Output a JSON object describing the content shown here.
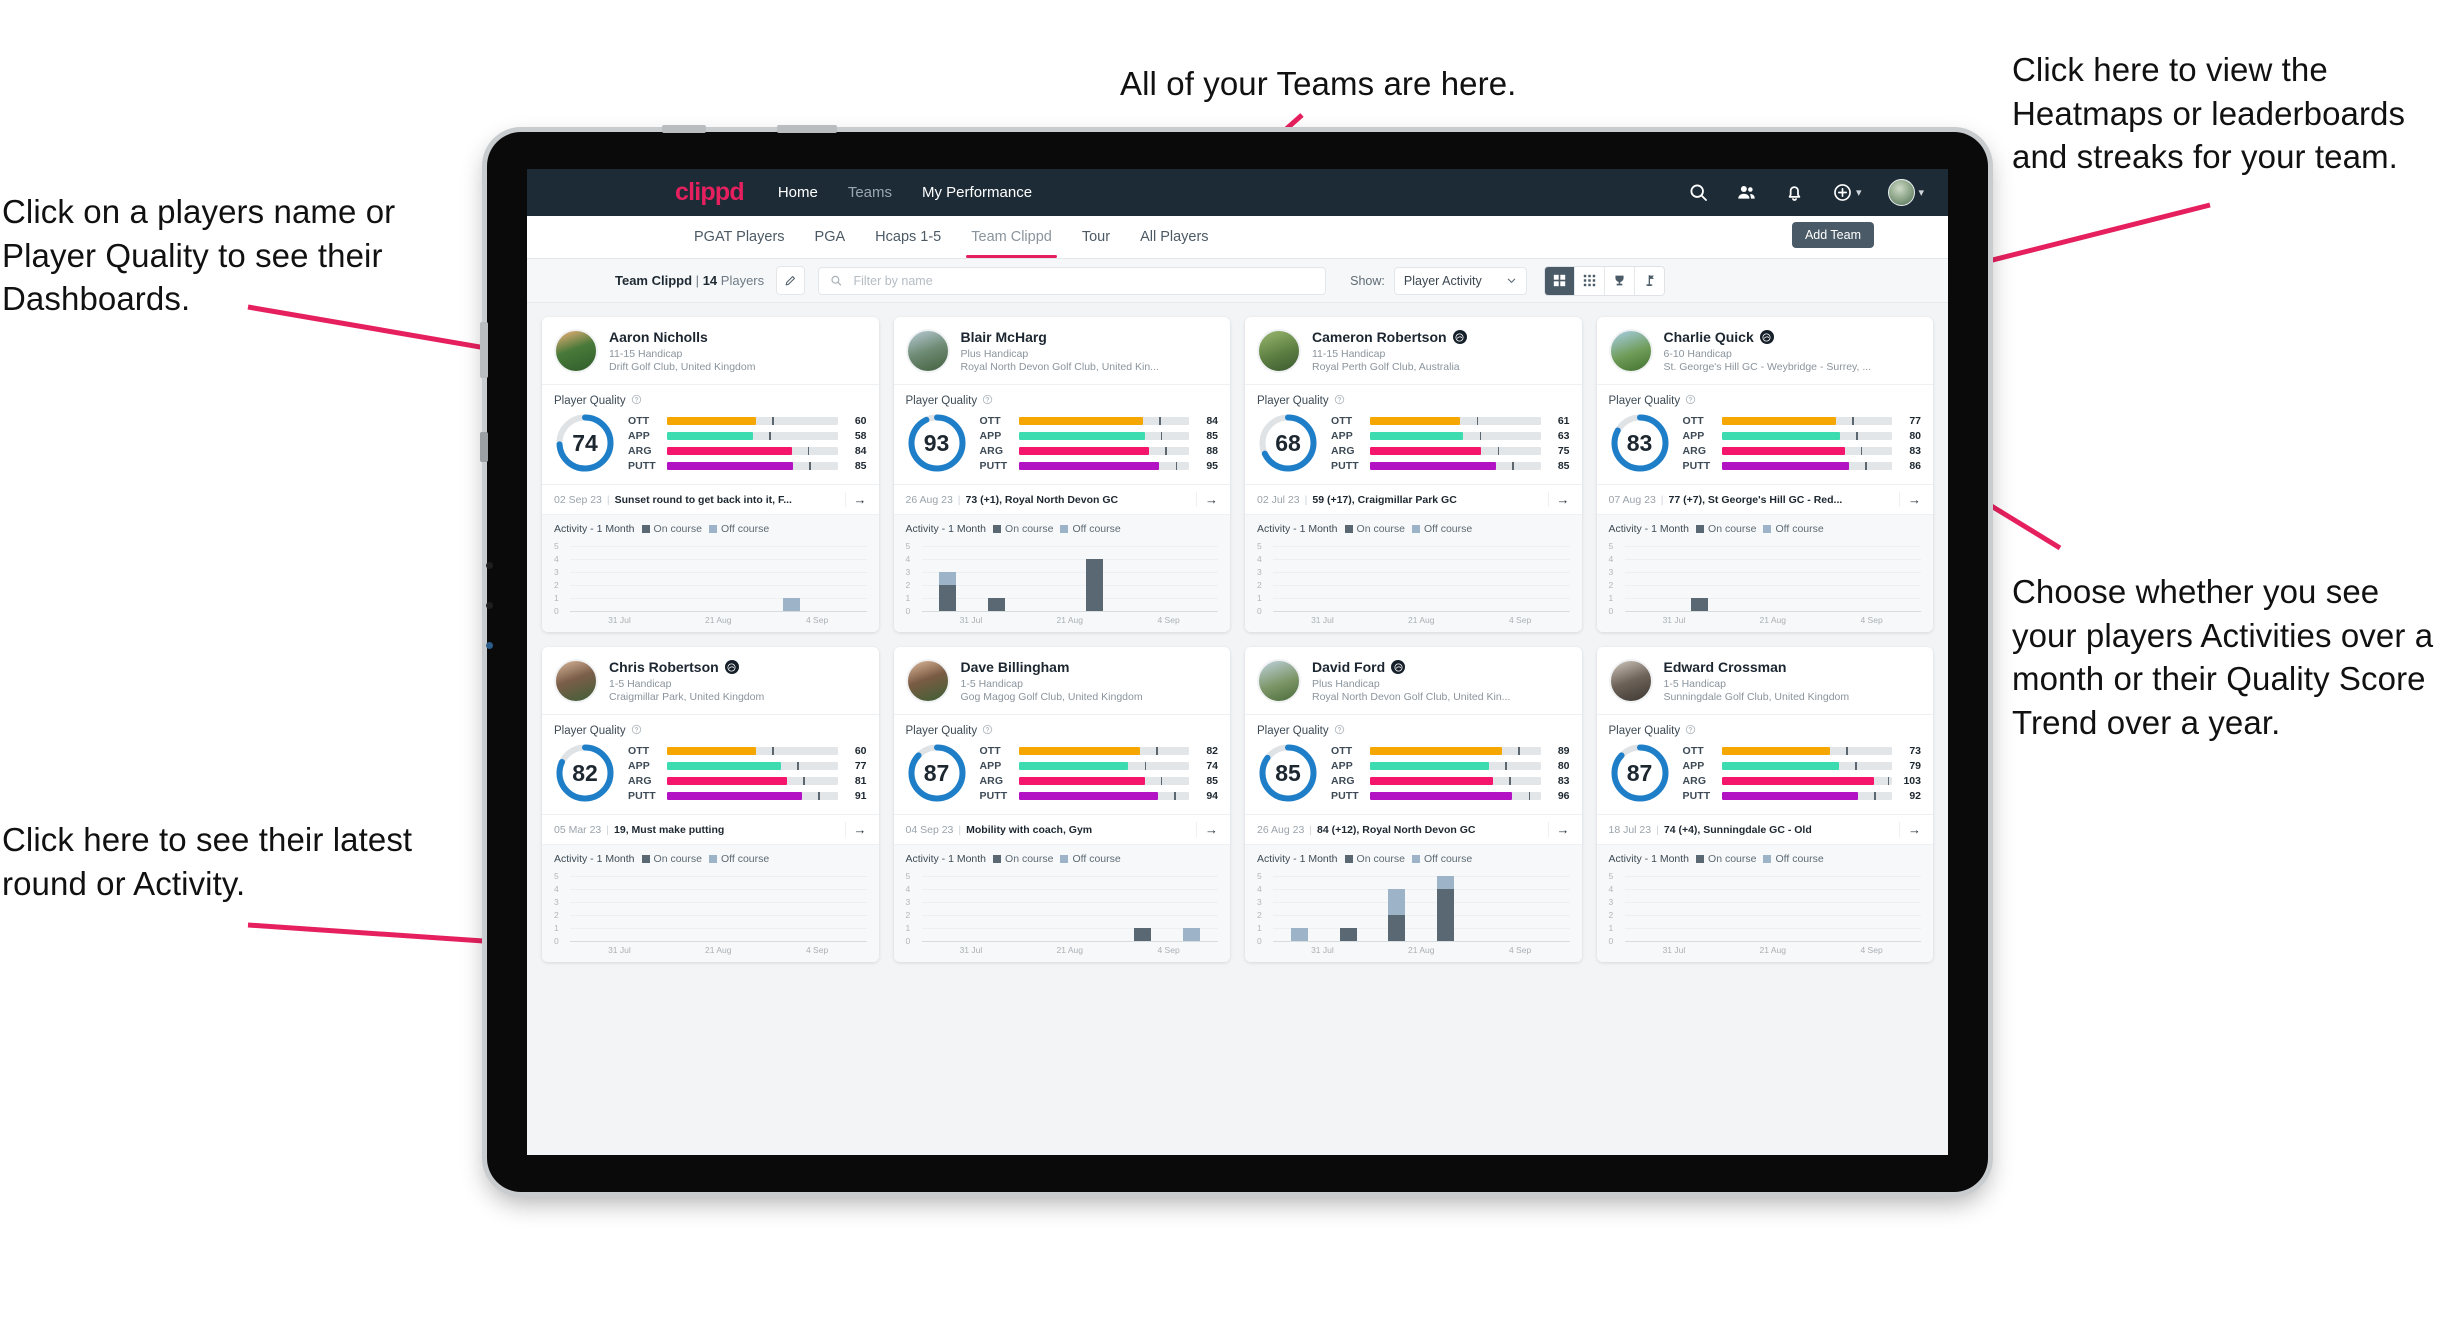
{
  "annotations": {
    "left_top": "Click on a players name or Player Quality to see their Dashboards.",
    "left_bottom": "Click here to see their latest round or Activity.",
    "top": "All of your Teams are here.",
    "right_top": "Click here to view the Heatmaps or leaderboards and streaks for your team.",
    "right_bottom": "Choose whether you see your players Activities over a month or their Quality Score Trend over a year."
  },
  "colors": {
    "accent": "#e6205e",
    "topnav_bg": "#1c2b36",
    "ott": "#f5a700",
    "app": "#3ddcb0",
    "arg": "#f5156c",
    "putt": "#b312c4",
    "donut": "#1e7ec8",
    "on_course": "#5a6873",
    "off_course": "#9db4c8"
  },
  "topnav": {
    "logo": "clippd",
    "links": [
      {
        "label": "Home",
        "active": true
      },
      {
        "label": "Teams",
        "active": false
      },
      {
        "label": "My Performance",
        "active": true
      }
    ],
    "icons": [
      "search-icon",
      "people-icon",
      "bell-icon",
      "add-circle-icon",
      "avatar"
    ]
  },
  "tabs": [
    {
      "label": "PGAT Players",
      "active": false
    },
    {
      "label": "PGA",
      "active": false
    },
    {
      "label": "Hcaps 1-5",
      "active": false
    },
    {
      "label": "Team Clippd",
      "active": true
    },
    {
      "label": "Tour",
      "active": false
    },
    {
      "label": "All Players",
      "active": false
    }
  ],
  "add_team_label": "Add Team",
  "filterbar": {
    "team_name": "Team Clippd",
    "separator": "|",
    "player_count": "14",
    "players_word": "Players",
    "edit_icon": "pencil-icon",
    "search_placeholder": "Filter by name",
    "search_value": "",
    "show_label": "Show:",
    "show_value": "Player Activity",
    "show_options": [
      "Player Activity",
      "Quality Score Trend"
    ],
    "view_buttons": [
      {
        "icon": "grid-view-icon",
        "active": true
      },
      {
        "icon": "dense-grid-icon",
        "active": false
      },
      {
        "icon": "trophy-icon",
        "active": false
      },
      {
        "icon": "flag-icon",
        "active": false
      }
    ]
  },
  "card_labels": {
    "player_quality": "Player Quality",
    "help_icon": "help-circle-icon",
    "activity": "Activity - 1 Month",
    "on_course": "On course",
    "off_course": "Off course",
    "arrow_icon": "arrow-right-icon"
  },
  "skill_keys": [
    "OTT",
    "APP",
    "ARG",
    "PUTT"
  ],
  "chart_axis": {
    "y_ticks": [
      "5",
      "4",
      "3",
      "2",
      "1",
      "0"
    ],
    "x_ticks": [
      "31 Jul",
      "21 Aug",
      "4 Sep"
    ],
    "ylim": [
      0,
      5
    ]
  },
  "players": [
    {
      "name": "Aaron Nicholls",
      "verified": false,
      "handicap": "11-15 Handicap",
      "club": "Drift Golf Club, United Kingdom",
      "quality": 74,
      "skills": {
        "OTT": 60,
        "APP": 58,
        "ARG": 84,
        "PUTT": 85
      },
      "last_date": "02 Sep 23",
      "last_text": "Sunset round to get back into it, F...",
      "chart_data": {
        "type": "bar",
        "title": "Activity - 1 Month",
        "categories": [
          "b1",
          "b2",
          "b3",
          "b4",
          "b5",
          "b6"
        ],
        "series": [
          {
            "name": "On course",
            "values": [
              0,
              0,
              0,
              0,
              0,
              0
            ]
          },
          {
            "name": "Off course",
            "values": [
              0,
              0,
              0,
              0,
              1,
              0
            ]
          }
        ],
        "ylim": [
          0,
          5
        ]
      }
    },
    {
      "name": "Blair McHarg",
      "verified": false,
      "handicap": "Plus Handicap",
      "club": "Royal North Devon Golf Club, United Kin...",
      "quality": 93,
      "skills": {
        "OTT": 84,
        "APP": 85,
        "ARG": 88,
        "PUTT": 95
      },
      "last_date": "26 Aug 23",
      "last_text": "73 (+1), Royal North Devon GC",
      "chart_data": {
        "type": "bar",
        "title": "Activity - 1 Month",
        "categories": [
          "b1",
          "b2",
          "b3",
          "b4",
          "b5",
          "b6"
        ],
        "series": [
          {
            "name": "On course",
            "values": [
              2,
              1,
              0,
              4,
              0,
              0
            ]
          },
          {
            "name": "Off course",
            "values": [
              1,
              0,
              0,
              0,
              0,
              0
            ]
          }
        ],
        "ylim": [
          0,
          5
        ]
      }
    },
    {
      "name": "Cameron Robertson",
      "verified": true,
      "handicap": "11-15 Handicap",
      "club": "Royal Perth Golf Club, Australia",
      "quality": 68,
      "skills": {
        "OTT": 61,
        "APP": 63,
        "ARG": 75,
        "PUTT": 85
      },
      "last_date": "02 Jul 23",
      "last_text": "59 (+17), Craigmillar Park GC",
      "chart_data": {
        "type": "bar",
        "title": "Activity - 1 Month",
        "categories": [
          "b1",
          "b2",
          "b3",
          "b4",
          "b5",
          "b6"
        ],
        "series": [
          {
            "name": "On course",
            "values": [
              0,
              0,
              0,
              0,
              0,
              0
            ]
          },
          {
            "name": "Off course",
            "values": [
              0,
              0,
              0,
              0,
              0,
              0
            ]
          }
        ],
        "ylim": [
          0,
          5
        ]
      }
    },
    {
      "name": "Charlie Quick",
      "verified": true,
      "handicap": "6-10 Handicap",
      "club": "St. George's Hill GC - Weybridge - Surrey, ...",
      "quality": 83,
      "skills": {
        "OTT": 77,
        "APP": 80,
        "ARG": 83,
        "PUTT": 86
      },
      "last_date": "07 Aug 23",
      "last_text": "77 (+7), St George's Hill GC - Red...",
      "chart_data": {
        "type": "bar",
        "title": "Activity - 1 Month",
        "categories": [
          "b1",
          "b2",
          "b3",
          "b4",
          "b5",
          "b6"
        ],
        "series": [
          {
            "name": "On course",
            "values": [
              0,
              1,
              0,
              0,
              0,
              0
            ]
          },
          {
            "name": "Off course",
            "values": [
              0,
              0,
              0,
              0,
              0,
              0
            ]
          }
        ],
        "ylim": [
          0,
          5
        ]
      }
    },
    {
      "name": "Chris Robertson",
      "verified": true,
      "handicap": "1-5 Handicap",
      "club": "Craigmillar Park, United Kingdom",
      "quality": 82,
      "skills": {
        "OTT": 60,
        "APP": 77,
        "ARG": 81,
        "PUTT": 91
      },
      "last_date": "05 Mar 23",
      "last_text": "19, Must make putting",
      "chart_data": {
        "type": "bar",
        "title": "Activity - 1 Month",
        "categories": [
          "b1",
          "b2",
          "b3",
          "b4",
          "b5",
          "b6"
        ],
        "series": [
          {
            "name": "On course",
            "values": [
              0,
              0,
              0,
              0,
              0,
              0
            ]
          },
          {
            "name": "Off course",
            "values": [
              0,
              0,
              0,
              0,
              0,
              0
            ]
          }
        ],
        "ylim": [
          0,
          5
        ]
      }
    },
    {
      "name": "Dave Billingham",
      "verified": false,
      "handicap": "1-5 Handicap",
      "club": "Gog Magog Golf Club, United Kingdom",
      "quality": 87,
      "skills": {
        "OTT": 82,
        "APP": 74,
        "ARG": 85,
        "PUTT": 94
      },
      "last_date": "04 Sep 23",
      "last_text": "Mobility with coach, Gym",
      "chart_data": {
        "type": "bar",
        "title": "Activity - 1 Month",
        "categories": [
          "b1",
          "b2",
          "b3",
          "b4",
          "b5",
          "b6"
        ],
        "series": [
          {
            "name": "On course",
            "values": [
              0,
              0,
              0,
              0,
              1,
              0
            ]
          },
          {
            "name": "Off course",
            "values": [
              0,
              0,
              0,
              0,
              0,
              1
            ]
          }
        ],
        "ylim": [
          0,
          5
        ]
      }
    },
    {
      "name": "David Ford",
      "verified": true,
      "handicap": "Plus Handicap",
      "club": "Royal North Devon Golf Club, United Kin...",
      "quality": 85,
      "skills": {
        "OTT": 89,
        "APP": 80,
        "ARG": 83,
        "PUTT": 96
      },
      "last_date": "26 Aug 23",
      "last_text": "84 (+12), Royal North Devon GC",
      "chart_data": {
        "type": "bar",
        "title": "Activity - 1 Month",
        "categories": [
          "b1",
          "b2",
          "b3",
          "b4",
          "b5",
          "b6"
        ],
        "series": [
          {
            "name": "On course",
            "values": [
              0,
              1,
              2,
              4,
              0,
              0
            ]
          },
          {
            "name": "Off course",
            "values": [
              1,
              0,
              2,
              1,
              0,
              0
            ]
          }
        ],
        "ylim": [
          0,
          5
        ]
      }
    },
    {
      "name": "Edward Crossman",
      "verified": false,
      "handicap": "1-5 Handicap",
      "club": "Sunningdale Golf Club, United Kingdom",
      "quality": 87,
      "skills": {
        "OTT": 73,
        "APP": 79,
        "ARG": 103,
        "PUTT": 92
      },
      "last_date": "18 Jul 23",
      "last_text": "74 (+4), Sunningdale GC - Old",
      "chart_data": {
        "type": "bar",
        "title": "Activity - 1 Month",
        "categories": [
          "b1",
          "b2",
          "b3",
          "b4",
          "b5",
          "b6"
        ],
        "series": [
          {
            "name": "On course",
            "values": [
              0,
              0,
              0,
              0,
              0,
              0
            ]
          },
          {
            "name": "Off course",
            "values": [
              0,
              0,
              0,
              0,
              0,
              0
            ]
          }
        ],
        "ylim": [
          0,
          5
        ]
      }
    }
  ]
}
